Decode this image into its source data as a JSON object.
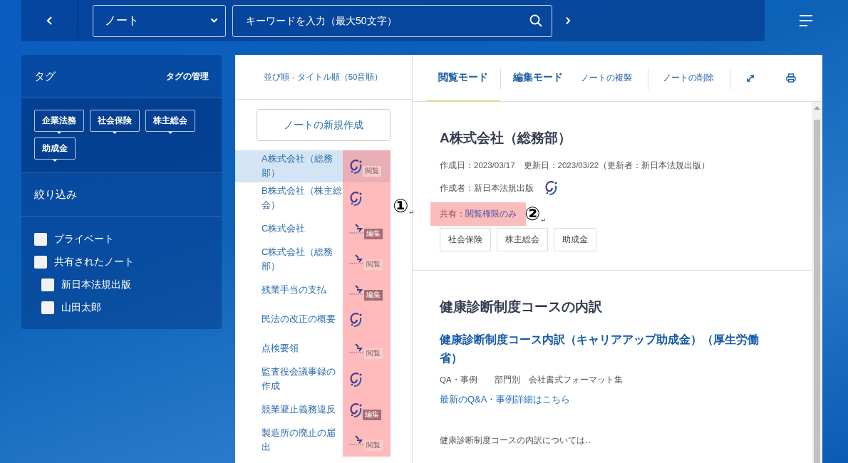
{
  "topbar": {
    "category": "ノート",
    "search": {
      "placeholder": "キーワードを入力（最大50文字）"
    }
  },
  "sidebar": {
    "tags_title": "タグ",
    "manage_link": "タグの管理",
    "tags": [
      "企業法務",
      "社会保険",
      "株主総会",
      "助成金"
    ],
    "filter_title": "絞り込み",
    "filters": [
      {
        "label": "プライベート",
        "checked": false
      },
      {
        "label": "共有されたノート",
        "checked": false,
        "children": [
          {
            "label": "新日本法規出版",
            "checked": false
          },
          {
            "label": "山田太郎",
            "checked": false
          }
        ]
      }
    ]
  },
  "note_list": {
    "sort_label": "並び順 - タイトル順（50音順）",
    "new_button": "ノートの新規作成",
    "items": [
      {
        "title": "A株式会社（総務部）",
        "selected": true,
        "kind": "publisher",
        "badge": {
          "text": "閲覧",
          "kind": "view"
        }
      },
      {
        "title": "B株式会社（株主総会）",
        "selected": false,
        "kind": "publisher"
      },
      {
        "title": "C株式会社",
        "selected": false,
        "kind": "user",
        "badge": {
          "text": "編集",
          "kind": "edit"
        }
      },
      {
        "title": "C株式会社（総務部）",
        "selected": false,
        "kind": "user",
        "badge": {
          "text": "閲覧",
          "kind": "view"
        }
      },
      {
        "title": "残業手当の支払",
        "selected": false,
        "kind": "user",
        "badge": {
          "text": "編集",
          "kind": "edit"
        }
      },
      {
        "title": "民法の改正の概要",
        "selected": false,
        "kind": "publisher"
      },
      {
        "title": "点検要領",
        "selected": false,
        "kind": "user",
        "badge": {
          "text": "閲覧",
          "kind": "view"
        }
      },
      {
        "title": "監査役会議事録の作成",
        "selected": false,
        "kind": "publisher"
      },
      {
        "title": "競業避止義務違反",
        "selected": false,
        "kind": "publisher",
        "badge": {
          "text": "編集",
          "kind": "edit"
        }
      },
      {
        "title": "製造所の廃止の届出",
        "selected": false,
        "kind": "user",
        "badge": {
          "text": "閲覧",
          "kind": "view"
        }
      }
    ]
  },
  "detail": {
    "tabs": [
      {
        "label": "閲覧モード",
        "selected": true
      },
      {
        "label": "編集モード",
        "selected": false
      }
    ],
    "actions": [
      "ノートの複製",
      "ノートの削除"
    ],
    "note": {
      "title": "A株式会社（総務部）",
      "dates": "作成日：2023/03/17　更新日：2023/03/22（更新者：新日本法規出版）",
      "author": "作成者：新日本法規出版",
      "share_label": "共有：",
      "share_value": "閲覧権限のみ",
      "tags": [
        "社会保険",
        "株主総会",
        "助成金"
      ]
    },
    "related": {
      "heading": "健康診断制度コースの内訳",
      "link_title": "健康診断制度コース内訳（キャリアアップ助成金）（厚生労働省）",
      "meta": "QA・事例　　部門別　会社書式フォーマット集",
      "more_link": "最新のQ&A・事例詳細はこちら",
      "excerpt": "健康診断制度コースの内訳については‥"
    }
  },
  "annotations": [
    {
      "label": "①",
      "mark": "↵"
    },
    {
      "label": "②",
      "mark": "↵"
    }
  ]
}
